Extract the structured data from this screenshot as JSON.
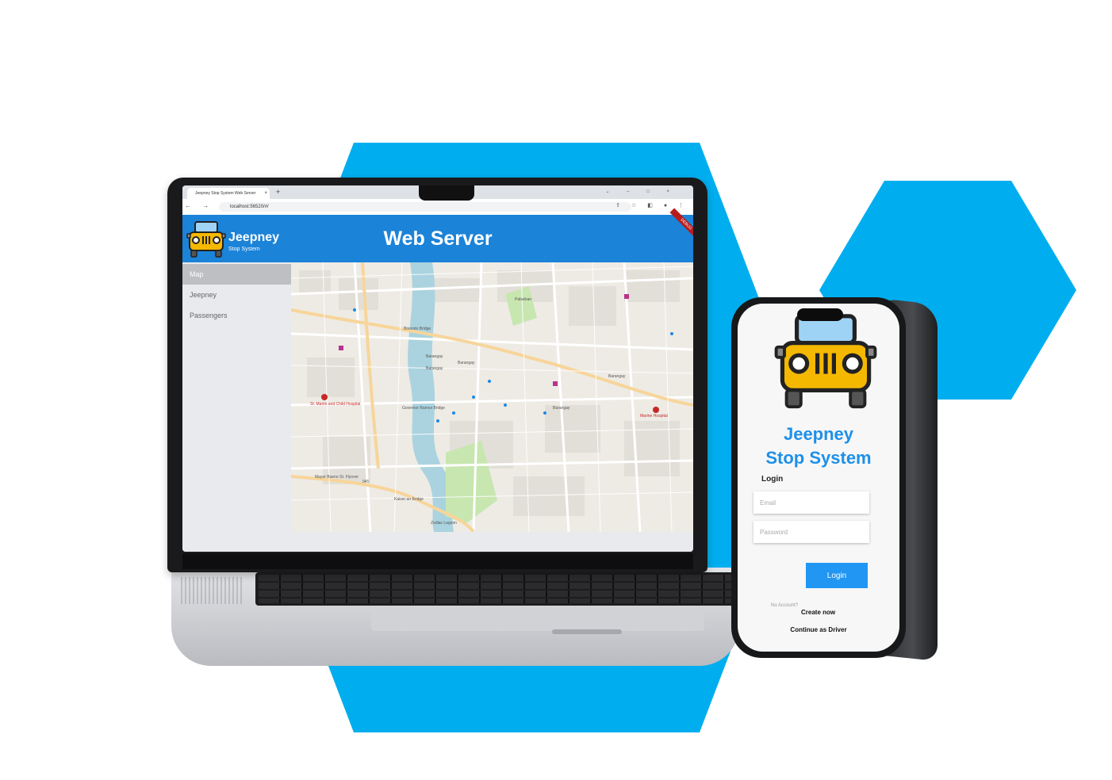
{
  "colors": {
    "hex_accent": "#00aeef",
    "header_blue": "#1b83d8",
    "phone_title_blue": "#1e90e8",
    "button_blue": "#2196f3",
    "jeep_yellow": "#f5b800"
  },
  "browser": {
    "tab_title": "Jeepney Stop System Web Server",
    "tab_close": "×",
    "new_tab": "+",
    "url": "localhost:56520/#/",
    "nav_glyphs": "← → C",
    "window_controls": "⌄ – □ ×",
    "toolbar_icons": "⇪ ☆ ◧ ● ⋮"
  },
  "web_app": {
    "brand_title": "Jeepney",
    "brand_subtitle": "Stop System",
    "header_title": "Web Server",
    "debug_banner": "DEBUG",
    "sidebar": [
      {
        "label": "Map",
        "active": true
      },
      {
        "label": "Jeepney",
        "active": false
      },
      {
        "label": "Passengers",
        "active": false
      }
    ],
    "map": {
      "labels": [
        "Pabaloan",
        "Binondo Bridge",
        "Barangay",
        "Barangay",
        "Barangay",
        "Barangay",
        "Barangay",
        "Governor Ramos Bridge",
        "Mayor Bueno St. Flyover",
        "Kaiser an Bridge",
        "Zodiac Lagoon",
        "Marine Hospital",
        "St. Martin and Child Hospital",
        "945"
      ]
    }
  },
  "mobile_app": {
    "title_line1": "Jeepney",
    "title_line2": "Stop System",
    "login_label": "Login",
    "email_placeholder": "Email",
    "password_placeholder": "Password",
    "login_button": "Login",
    "no_account_text": "No Account?",
    "create_now": "Create now",
    "continue_driver": "Continue as Driver"
  },
  "icons": {
    "hex_background": "hexagon-shape",
    "logo": "jeep-icon",
    "map_pins": "map-marker-icon"
  }
}
